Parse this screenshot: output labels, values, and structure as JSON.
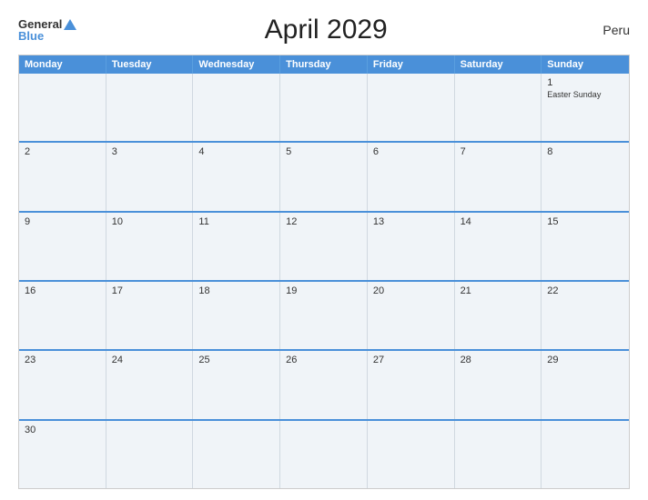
{
  "header": {
    "logo_general": "General",
    "logo_blue": "Blue",
    "title": "April 2029",
    "country": "Peru"
  },
  "calendar": {
    "days_of_week": [
      "Monday",
      "Tuesday",
      "Wednesday",
      "Thursday",
      "Friday",
      "Saturday",
      "Sunday"
    ],
    "weeks": [
      [
        {
          "day": "",
          "events": []
        },
        {
          "day": "",
          "events": []
        },
        {
          "day": "",
          "events": []
        },
        {
          "day": "",
          "events": []
        },
        {
          "day": "",
          "events": []
        },
        {
          "day": "",
          "events": []
        },
        {
          "day": "1",
          "events": [
            "Easter Sunday"
          ]
        }
      ],
      [
        {
          "day": "2",
          "events": []
        },
        {
          "day": "3",
          "events": []
        },
        {
          "day": "4",
          "events": []
        },
        {
          "day": "5",
          "events": []
        },
        {
          "day": "6",
          "events": []
        },
        {
          "day": "7",
          "events": []
        },
        {
          "day": "8",
          "events": []
        }
      ],
      [
        {
          "day": "9",
          "events": []
        },
        {
          "day": "10",
          "events": []
        },
        {
          "day": "11",
          "events": []
        },
        {
          "day": "12",
          "events": []
        },
        {
          "day": "13",
          "events": []
        },
        {
          "day": "14",
          "events": []
        },
        {
          "day": "15",
          "events": []
        }
      ],
      [
        {
          "day": "16",
          "events": []
        },
        {
          "day": "17",
          "events": []
        },
        {
          "day": "18",
          "events": []
        },
        {
          "day": "19",
          "events": []
        },
        {
          "day": "20",
          "events": []
        },
        {
          "day": "21",
          "events": []
        },
        {
          "day": "22",
          "events": []
        }
      ],
      [
        {
          "day": "23",
          "events": []
        },
        {
          "day": "24",
          "events": []
        },
        {
          "day": "25",
          "events": []
        },
        {
          "day": "26",
          "events": []
        },
        {
          "day": "27",
          "events": []
        },
        {
          "day": "28",
          "events": []
        },
        {
          "day": "29",
          "events": []
        }
      ],
      [
        {
          "day": "30",
          "events": []
        },
        {
          "day": "",
          "events": []
        },
        {
          "day": "",
          "events": []
        },
        {
          "day": "",
          "events": []
        },
        {
          "day": "",
          "events": []
        },
        {
          "day": "",
          "events": []
        },
        {
          "day": "",
          "events": []
        }
      ]
    ]
  }
}
